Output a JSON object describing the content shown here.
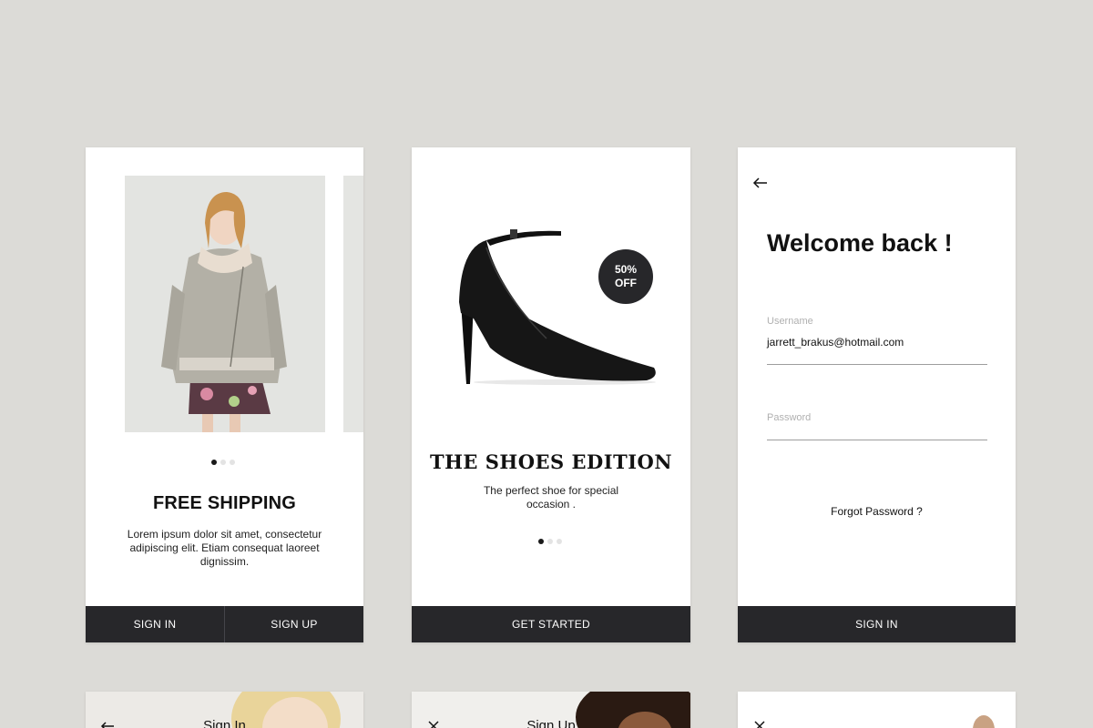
{
  "colors": {
    "background": "#dcdbd7",
    "card": "#ffffff",
    "button_bar": "#27272a",
    "accent_dark": "#27272a"
  },
  "card1": {
    "title": "FREE SHIPPING",
    "description": "Lorem ipsum dolor sit amet, consectetur adipiscing elit. Etiam consequat laoreet dignissim.",
    "carousel": {
      "count": 3,
      "active": 1
    },
    "buttons": {
      "sign_in": "SIGN IN",
      "sign_up": "SIGN UP"
    }
  },
  "card2": {
    "badge": {
      "line1": "50%",
      "line2": "OFF"
    },
    "title": "THE SHOES EDITION",
    "description": "The perfect shoe for special occasion .",
    "carousel": {
      "count": 3,
      "active": 1
    },
    "buttons": {
      "get_started": "GET STARTED"
    }
  },
  "card3": {
    "back_icon": "arrow-left-icon",
    "heading": "Welcome back !",
    "username_label": "Username",
    "username_value": "jarrett_brakus@hotmail.com",
    "password_label": "Password",
    "forgot_password": "Forgot Password ?",
    "buttons": {
      "sign_in": "SIGN IN"
    }
  },
  "bottom_cards": [
    {
      "icon": "arrow-left-icon",
      "title": "Sign In"
    },
    {
      "icon": "close-icon",
      "title": "Sign Up"
    },
    {
      "icon": "close-icon",
      "title": ""
    }
  ]
}
